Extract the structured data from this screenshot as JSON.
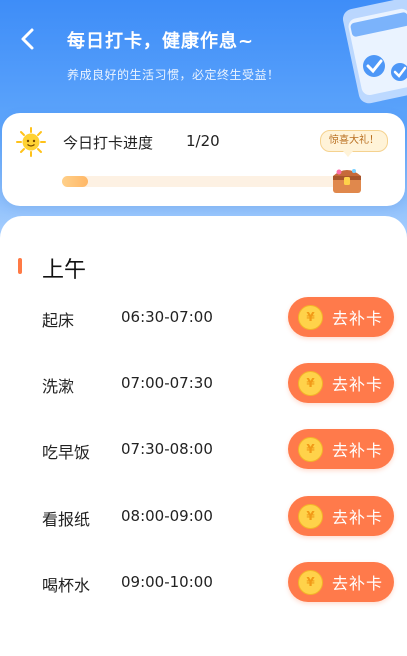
{
  "header": {
    "title": "每日打卡，健康作息~",
    "subtitle": "养成良好的生活习惯，必定终生受益！"
  },
  "progress": {
    "label": "今日打卡进度",
    "count_text": "1/20",
    "completed": 1,
    "total": 20,
    "gift_text": "惊喜大礼！"
  },
  "section": {
    "title": "上午"
  },
  "schedule": [
    {
      "name": "起床",
      "time": "06:30-07:00",
      "button": "去补卡",
      "coin": "¥"
    },
    {
      "name": "洗漱",
      "time": "07:00-07:30",
      "button": "去补卡",
      "coin": "¥"
    },
    {
      "name": "吃早饭",
      "time": "07:30-08:00",
      "button": "去补卡",
      "coin": "¥"
    },
    {
      "name": "看报纸",
      "time": "08:00-09:00",
      "button": "去补卡",
      "coin": "¥"
    },
    {
      "name": "喝杯水",
      "time": "09:00-10:00",
      "button": "去补卡",
      "coin": "¥"
    }
  ],
  "colors": {
    "header_blue": "#3e8df8",
    "accent_orange": "#ff7a4b",
    "coin_yellow": "#ffd24a"
  },
  "icons": {
    "back": "chevron-left-icon",
    "sun": "sun-icon",
    "chest": "treasure-chest-icon",
    "coin": "coin-icon",
    "illustration": "calendar-checklist-icon"
  }
}
